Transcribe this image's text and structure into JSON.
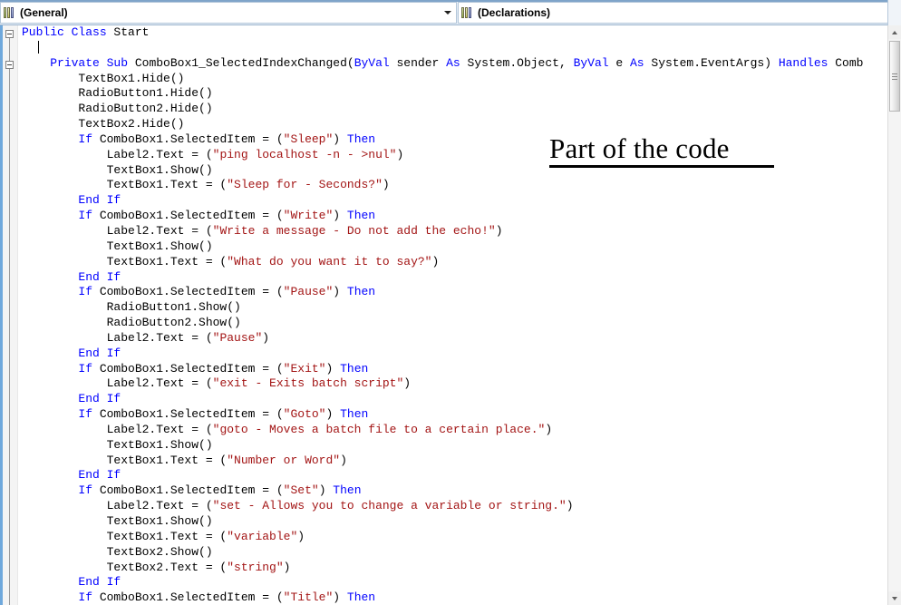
{
  "window": {
    "kind": "visual-basic-code-editor"
  },
  "toolbar": {
    "scope_combo": {
      "value": "(General)",
      "icon": "module-icon",
      "arrow_icon": "chevron-down-icon"
    },
    "member_combo": {
      "value": "(Declarations)",
      "icon": "module-icon",
      "arrow_icon": "chevron-down-icon"
    }
  },
  "annotation": {
    "text": "Part of the code"
  },
  "scrollbar": {
    "up_arrow": "scroll-up-icon",
    "down_arrow": "scroll-down-icon",
    "thumb": "scroll-thumb"
  },
  "gutter": {
    "collapse_icon": "collapse-minus-icon"
  },
  "code": {
    "lines": [
      [
        {
          "t": "kw",
          "s": "Public Class "
        },
        {
          "t": "pl",
          "s": "Start"
        }
      ],
      [],
      [
        {
          "t": "pl",
          "s": "    "
        },
        {
          "t": "kw",
          "s": "Private Sub "
        },
        {
          "t": "pl",
          "s": "ComboBox1_SelectedIndexChanged("
        },
        {
          "t": "kw",
          "s": "ByVal"
        },
        {
          "t": "pl",
          "s": " sender "
        },
        {
          "t": "kw",
          "s": "As"
        },
        {
          "t": "pl",
          "s": " System.Object, "
        },
        {
          "t": "kw",
          "s": "ByVal"
        },
        {
          "t": "pl",
          "s": " e "
        },
        {
          "t": "kw",
          "s": "As"
        },
        {
          "t": "pl",
          "s": " System.EventArgs) "
        },
        {
          "t": "kw",
          "s": "Handles"
        },
        {
          "t": "pl",
          "s": " Comb"
        }
      ],
      [
        {
          "t": "pl",
          "s": "        TextBox1.Hide()"
        }
      ],
      [
        {
          "t": "pl",
          "s": "        RadioButton1.Hide()"
        }
      ],
      [
        {
          "t": "pl",
          "s": "        RadioButton2.Hide()"
        }
      ],
      [
        {
          "t": "pl",
          "s": "        TextBox2.Hide()"
        }
      ],
      [
        {
          "t": "pl",
          "s": "        "
        },
        {
          "t": "kw",
          "s": "If"
        },
        {
          "t": "pl",
          "s": " ComboBox1.SelectedItem = ("
        },
        {
          "t": "str",
          "s": "\"Sleep\""
        },
        {
          "t": "pl",
          "s": ") "
        },
        {
          "t": "kw",
          "s": "Then"
        }
      ],
      [
        {
          "t": "pl",
          "s": "            Label2.Text = ("
        },
        {
          "t": "str",
          "s": "\"ping localhost -n - >nul\""
        },
        {
          "t": "pl",
          "s": ")"
        }
      ],
      [
        {
          "t": "pl",
          "s": "            TextBox1.Show()"
        }
      ],
      [
        {
          "t": "pl",
          "s": "            TextBox1.Text = ("
        },
        {
          "t": "str",
          "s": "\"Sleep for - Seconds?\""
        },
        {
          "t": "pl",
          "s": ")"
        }
      ],
      [
        {
          "t": "pl",
          "s": "        "
        },
        {
          "t": "kw",
          "s": "End If"
        }
      ],
      [
        {
          "t": "pl",
          "s": "        "
        },
        {
          "t": "kw",
          "s": "If"
        },
        {
          "t": "pl",
          "s": " ComboBox1.SelectedItem = ("
        },
        {
          "t": "str",
          "s": "\"Write\""
        },
        {
          "t": "pl",
          "s": ") "
        },
        {
          "t": "kw",
          "s": "Then"
        }
      ],
      [
        {
          "t": "pl",
          "s": "            Label2.Text = ("
        },
        {
          "t": "str",
          "s": "\"Write a message - Do not add the echo!\""
        },
        {
          "t": "pl",
          "s": ")"
        }
      ],
      [
        {
          "t": "pl",
          "s": "            TextBox1.Show()"
        }
      ],
      [
        {
          "t": "pl",
          "s": "            TextBox1.Text = ("
        },
        {
          "t": "str",
          "s": "\"What do you want it to say?\""
        },
        {
          "t": "pl",
          "s": ")"
        }
      ],
      [
        {
          "t": "pl",
          "s": "        "
        },
        {
          "t": "kw",
          "s": "End If"
        }
      ],
      [
        {
          "t": "pl",
          "s": "        "
        },
        {
          "t": "kw",
          "s": "If"
        },
        {
          "t": "pl",
          "s": " ComboBox1.SelectedItem = ("
        },
        {
          "t": "str",
          "s": "\"Pause\""
        },
        {
          "t": "pl",
          "s": ") "
        },
        {
          "t": "kw",
          "s": "Then"
        }
      ],
      [
        {
          "t": "pl",
          "s": "            RadioButton1.Show()"
        }
      ],
      [
        {
          "t": "pl",
          "s": "            RadioButton2.Show()"
        }
      ],
      [
        {
          "t": "pl",
          "s": "            Label2.Text = ("
        },
        {
          "t": "str",
          "s": "\"Pause\""
        },
        {
          "t": "pl",
          "s": ")"
        }
      ],
      [
        {
          "t": "pl",
          "s": "        "
        },
        {
          "t": "kw",
          "s": "End If"
        }
      ],
      [
        {
          "t": "pl",
          "s": "        "
        },
        {
          "t": "kw",
          "s": "If"
        },
        {
          "t": "pl",
          "s": " ComboBox1.SelectedItem = ("
        },
        {
          "t": "str",
          "s": "\"Exit\""
        },
        {
          "t": "pl",
          "s": ") "
        },
        {
          "t": "kw",
          "s": "Then"
        }
      ],
      [
        {
          "t": "pl",
          "s": "            Label2.Text = ("
        },
        {
          "t": "str",
          "s": "\"exit - Exits batch script\""
        },
        {
          "t": "pl",
          "s": ")"
        }
      ],
      [
        {
          "t": "pl",
          "s": "        "
        },
        {
          "t": "kw",
          "s": "End If"
        }
      ],
      [
        {
          "t": "pl",
          "s": "        "
        },
        {
          "t": "kw",
          "s": "If"
        },
        {
          "t": "pl",
          "s": " ComboBox1.SelectedItem = ("
        },
        {
          "t": "str",
          "s": "\"Goto\""
        },
        {
          "t": "pl",
          "s": ") "
        },
        {
          "t": "kw",
          "s": "Then"
        }
      ],
      [
        {
          "t": "pl",
          "s": "            Label2.Text = ("
        },
        {
          "t": "str",
          "s": "\"goto - Moves a batch file to a certain place.\""
        },
        {
          "t": "pl",
          "s": ")"
        }
      ],
      [
        {
          "t": "pl",
          "s": "            TextBox1.Show()"
        }
      ],
      [
        {
          "t": "pl",
          "s": "            TextBox1.Text = ("
        },
        {
          "t": "str",
          "s": "\"Number or Word\""
        },
        {
          "t": "pl",
          "s": ")"
        }
      ],
      [
        {
          "t": "pl",
          "s": "        "
        },
        {
          "t": "kw",
          "s": "End If"
        }
      ],
      [
        {
          "t": "pl",
          "s": "        "
        },
        {
          "t": "kw",
          "s": "If"
        },
        {
          "t": "pl",
          "s": " ComboBox1.SelectedItem = ("
        },
        {
          "t": "str",
          "s": "\"Set\""
        },
        {
          "t": "pl",
          "s": ") "
        },
        {
          "t": "kw",
          "s": "Then"
        }
      ],
      [
        {
          "t": "pl",
          "s": "            Label2.Text = ("
        },
        {
          "t": "str",
          "s": "\"set - Allows you to change a variable or string.\""
        },
        {
          "t": "pl",
          "s": ")"
        }
      ],
      [
        {
          "t": "pl",
          "s": "            TextBox1.Show()"
        }
      ],
      [
        {
          "t": "pl",
          "s": "            TextBox1.Text = ("
        },
        {
          "t": "str",
          "s": "\"variable\""
        },
        {
          "t": "pl",
          "s": ")"
        }
      ],
      [
        {
          "t": "pl",
          "s": "            TextBox2.Show()"
        }
      ],
      [
        {
          "t": "pl",
          "s": "            TextBox2.Text = ("
        },
        {
          "t": "str",
          "s": "\"string\""
        },
        {
          "t": "pl",
          "s": ")"
        }
      ],
      [
        {
          "t": "pl",
          "s": "        "
        },
        {
          "t": "kw",
          "s": "End If"
        }
      ],
      [
        {
          "t": "pl",
          "s": "        "
        },
        {
          "t": "kw",
          "s": "If"
        },
        {
          "t": "pl",
          "s": " ComboBox1.SelectedItem = ("
        },
        {
          "t": "str",
          "s": "\"Title\""
        },
        {
          "t": "pl",
          "s": ") "
        },
        {
          "t": "kw",
          "s": "Then"
        }
      ]
    ]
  }
}
